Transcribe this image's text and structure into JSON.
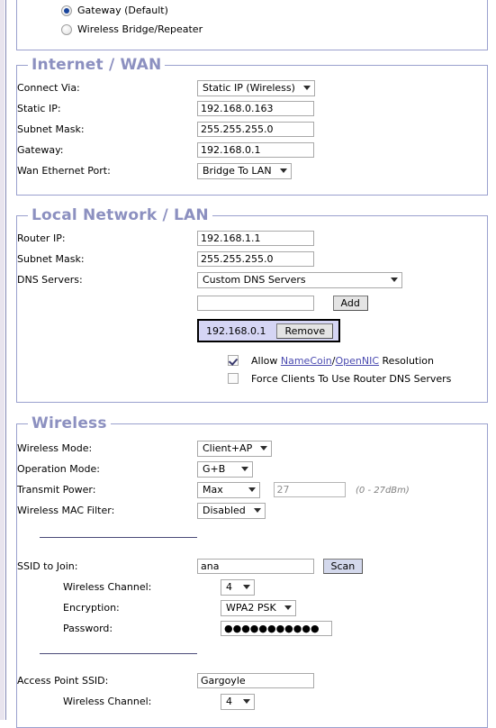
{
  "operating_mode": {
    "options": [
      {
        "label": "Gateway (Default)",
        "selected": true
      },
      {
        "label": "Wireless Bridge/Repeater",
        "selected": false
      }
    ]
  },
  "wan": {
    "title": "Internet / WAN",
    "connect_via_label": "Connect Via:",
    "connect_via_value": "Static IP (Wireless)",
    "static_ip_label": "Static IP:",
    "static_ip_value": "192.168.0.163",
    "subnet_mask_label": "Subnet Mask:",
    "subnet_mask_value": "255.255.255.0",
    "gateway_label": "Gateway:",
    "gateway_value": "192.168.0.1",
    "wan_port_label": "Wan Ethernet Port:",
    "wan_port_value": "Bridge To LAN"
  },
  "lan": {
    "title": "Local Network / LAN",
    "router_ip_label": "Router IP:",
    "router_ip_value": "192.168.1.1",
    "subnet_mask_label": "Subnet Mask:",
    "subnet_mask_value": "255.255.255.0",
    "dns_servers_label": "DNS Servers:",
    "dns_servers_value": "Custom DNS Servers",
    "dns_add_input_value": "",
    "dns_add_button": "Add",
    "dns_entry_ip": "192.168.0.1",
    "dns_entry_remove_button": "Remove",
    "allow_prefix": "Allow ",
    "allow_link1": "NameCoin",
    "allow_sep": "/",
    "allow_link2": "OpenNIC",
    "allow_suffix": " Resolution",
    "allow_checked": true,
    "force_dns_label": "Force Clients To Use Router DNS Servers",
    "force_dns_checked": false
  },
  "wireless": {
    "title": "Wireless",
    "wireless_mode_label": "Wireless Mode:",
    "wireless_mode_value": "Client+AP",
    "operation_mode_label": "Operation Mode:",
    "operation_mode_value": "G+B",
    "transmit_power_label": "Transmit Power:",
    "transmit_power_value": "Max",
    "transmit_power_dbm": "27",
    "transmit_power_hint": "(0 - 27dBm)",
    "mac_filter_label": "Wireless MAC Filter:",
    "mac_filter_value": "Disabled",
    "ssid_join_label": "SSID to Join:",
    "ssid_join_value": "ana",
    "scan_button": "Scan",
    "client_channel_label": "Wireless Channel:",
    "client_channel_value": "4",
    "encryption_label": "Encryption:",
    "encryption_value": "WPA2 PSK",
    "password_label": "Password:",
    "password_value": "●●●●●●●●●●●",
    "ap_ssid_label": "Access Point SSID:",
    "ap_ssid_value": "Gargoyle",
    "ap_channel_label": "Wireless Channel:",
    "ap_channel_value": "4"
  },
  "colors": {
    "panel_border": "#9aa0ce",
    "legend_text": "#8c90c0",
    "button_face": "#d3d8ec",
    "dns_list_bg": "#d5d5f4",
    "link": "#4b4bb0"
  }
}
